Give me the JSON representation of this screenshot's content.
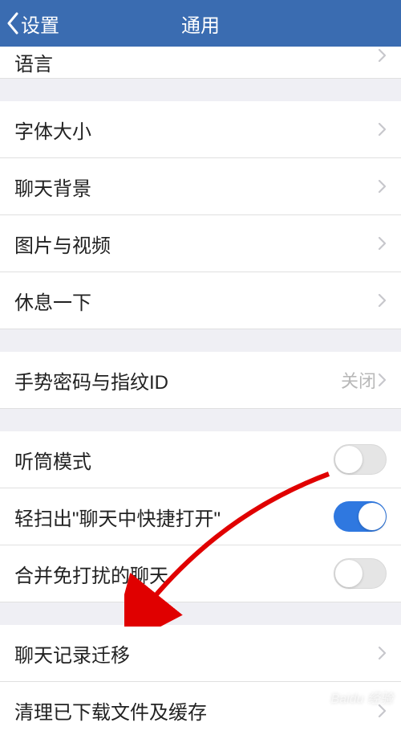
{
  "header": {
    "back_label": "设置",
    "title": "通用"
  },
  "rows": {
    "language": {
      "label": "语言"
    },
    "font_size": {
      "label": "字体大小"
    },
    "chat_bg": {
      "label": "聊天背景"
    },
    "media": {
      "label": "图片与视频"
    },
    "rest": {
      "label": "休息一下"
    },
    "gesture": {
      "label": "手势密码与指纹ID",
      "value": "关闭"
    },
    "earpiece": {
      "label": "听筒模式",
      "toggle": false
    },
    "swipe_quick": {
      "label": "轻扫出\"聊天中快捷打开\"",
      "toggle": true
    },
    "merge_dnd": {
      "label": "合并免打扰的聊天",
      "toggle": false
    },
    "chat_migrate": {
      "label": "聊天记录迁移"
    },
    "clear_cache": {
      "label": "清理已下载文件及缓存"
    }
  },
  "watermark": "Baidu 经验"
}
